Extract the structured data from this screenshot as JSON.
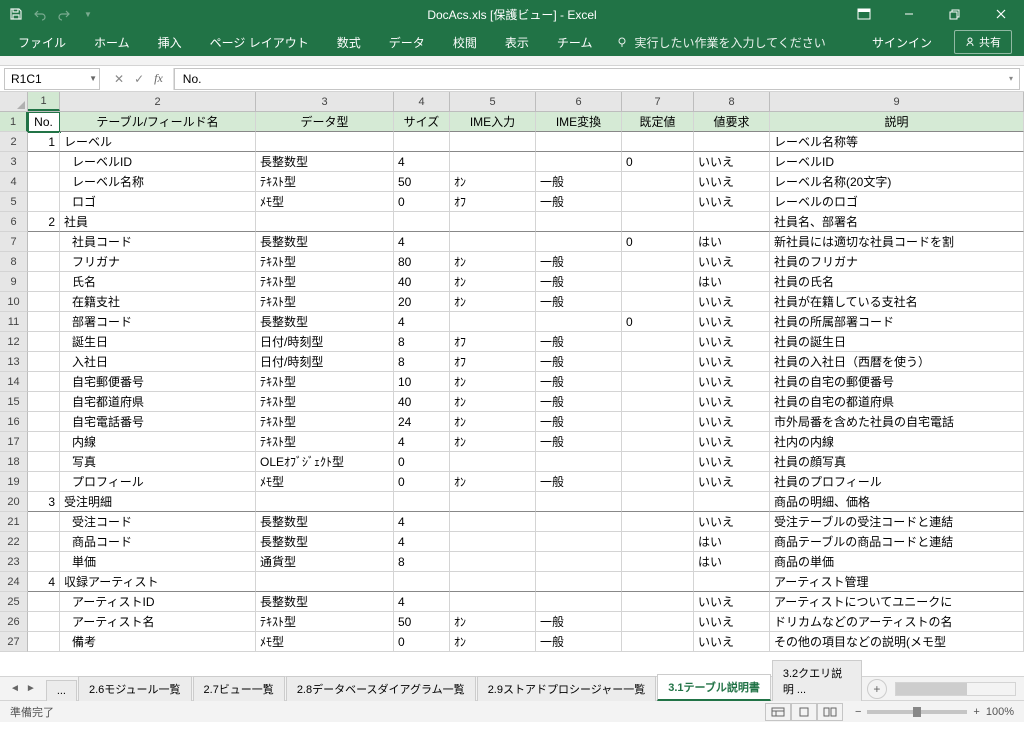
{
  "title": "DocAcs.xls [保護ビュー] - Excel",
  "qat": {
    "save": "save",
    "undo": "undo",
    "redo": "redo"
  },
  "ribbon_tabs": [
    "ファイル",
    "ホーム",
    "挿入",
    "ページ レイアウト",
    "数式",
    "データ",
    "校閲",
    "表示",
    "チーム"
  ],
  "tell_me": "実行したい作業を入力してください",
  "signin": "サインイン",
  "share": "共有",
  "name_box": "R1C1",
  "formula_value": "No.",
  "col_headers": [
    "1",
    "2",
    "3",
    "4",
    "5",
    "6",
    "7",
    "8",
    "9"
  ],
  "header_row": [
    "No.",
    "テーブル/フィールド名",
    "データ型",
    "サイズ",
    "IME入力",
    "IME変換",
    "既定値",
    "値要求",
    "説明"
  ],
  "rows": [
    {
      "s": true,
      "no": "1",
      "c": [
        "レーベル",
        "",
        "",
        "",
        "",
        "",
        "",
        "レーベル名称等"
      ]
    },
    {
      "c": [
        "レーベルID",
        "長整数型",
        "4",
        "",
        "",
        "0",
        "いいえ",
        "レーベルID"
      ]
    },
    {
      "c": [
        "レーベル名称",
        "ﾃｷｽﾄ型",
        "50",
        "ｵﾝ",
        "一般",
        "",
        "いいえ",
        "レーベル名称(20文字)"
      ]
    },
    {
      "c": [
        "ロゴ",
        "ﾒﾓ型",
        "0",
        "ｵﾌ",
        "一般",
        "",
        "いいえ",
        "レーベルのロゴ"
      ]
    },
    {
      "s": true,
      "no": "2",
      "c": [
        "社員",
        "",
        "",
        "",
        "",
        "",
        "",
        "社員名、部署名"
      ]
    },
    {
      "c": [
        "社員コード",
        "長整数型",
        "4",
        "",
        "",
        "0",
        "はい",
        "新社員には適切な社員コードを割"
      ]
    },
    {
      "c": [
        "フリガナ",
        "ﾃｷｽﾄ型",
        "80",
        "ｵﾝ",
        "一般",
        "",
        "いいえ",
        "社員のフリガナ"
      ]
    },
    {
      "c": [
        "氏名",
        "ﾃｷｽﾄ型",
        "40",
        "ｵﾝ",
        "一般",
        "",
        "はい",
        "社員の氏名"
      ]
    },
    {
      "c": [
        "在籍支社",
        "ﾃｷｽﾄ型",
        "20",
        "ｵﾝ",
        "一般",
        "",
        "いいえ",
        "社員が在籍している支社名"
      ]
    },
    {
      "c": [
        "部署コード",
        "長整数型",
        "4",
        "",
        "",
        "0",
        "いいえ",
        "社員の所属部署コード"
      ]
    },
    {
      "c": [
        "誕生日",
        "日付/時刻型",
        "8",
        "ｵﾌ",
        "一般",
        "",
        "いいえ",
        "社員の誕生日"
      ]
    },
    {
      "c": [
        "入社日",
        "日付/時刻型",
        "8",
        "ｵﾌ",
        "一般",
        "",
        "いいえ",
        "社員の入社日（西暦を使う）"
      ]
    },
    {
      "c": [
        "自宅郵便番号",
        "ﾃｷｽﾄ型",
        "10",
        "ｵﾝ",
        "一般",
        "",
        "いいえ",
        "社員の自宅の郵便番号"
      ]
    },
    {
      "c": [
        "自宅都道府県",
        "ﾃｷｽﾄ型",
        "40",
        "ｵﾝ",
        "一般",
        "",
        "いいえ",
        "社員の自宅の都道府県"
      ]
    },
    {
      "c": [
        "自宅電話番号",
        "ﾃｷｽﾄ型",
        "24",
        "ｵﾝ",
        "一般",
        "",
        "いいえ",
        "市外局番を含めた社員の自宅電話"
      ]
    },
    {
      "c": [
        "内線",
        "ﾃｷｽﾄ型",
        "4",
        "ｵﾝ",
        "一般",
        "",
        "いいえ",
        "社内の内線"
      ]
    },
    {
      "c": [
        "写真",
        "OLEｵﾌﾞｼﾞｪｸﾄ型",
        "0",
        "",
        "",
        "",
        "いいえ",
        "社員の顔写真"
      ]
    },
    {
      "c": [
        "プロフィール",
        "ﾒﾓ型",
        "0",
        "ｵﾝ",
        "一般",
        "",
        "いいえ",
        "社員のプロフィール"
      ]
    },
    {
      "s": true,
      "no": "3",
      "c": [
        "受注明細",
        "",
        "",
        "",
        "",
        "",
        "",
        "商品の明細、価格"
      ]
    },
    {
      "c": [
        "受注コード",
        "長整数型",
        "4",
        "",
        "",
        "",
        "いいえ",
        "受注テーブルの受注コードと連結"
      ]
    },
    {
      "c": [
        "商品コード",
        "長整数型",
        "4",
        "",
        "",
        "",
        "はい",
        "商品テーブルの商品コードと連結"
      ]
    },
    {
      "c": [
        "単価",
        "通貨型",
        "8",
        "",
        "",
        "",
        "はい",
        "商品の単価"
      ]
    },
    {
      "s": true,
      "no": "4",
      "c": [
        "収録アーティスト",
        "",
        "",
        "",
        "",
        "",
        "",
        "アーティスト管理"
      ]
    },
    {
      "c": [
        "アーティストID",
        "長整数型",
        "4",
        "",
        "",
        "",
        "いいえ",
        "アーティストについてユニークに"
      ]
    },
    {
      "c": [
        "アーティスト名",
        "ﾃｷｽﾄ型",
        "50",
        "ｵﾝ",
        "一般",
        "",
        "いいえ",
        "ドリカムなどのアーティストの名"
      ]
    },
    {
      "c": [
        "備考",
        "ﾒﾓ型",
        "0",
        "ｵﾝ",
        "一般",
        "",
        "いいえ",
        "その他の項目などの説明(メモ型"
      ]
    }
  ],
  "sheet_tabs": [
    {
      "label": "...",
      "active": false,
      "trunc": true
    },
    {
      "label": "2.6モジュール一覧",
      "active": false
    },
    {
      "label": "2.7ビュー一覧",
      "active": false
    },
    {
      "label": "2.8データベースダイアグラム一覧",
      "active": false
    },
    {
      "label": "2.9ストアドプロシージャー一覧",
      "active": false
    },
    {
      "label": "3.1テーブル説明書",
      "active": true
    },
    {
      "label": "3.2クエリ説明 ...",
      "active": false,
      "trunc": true
    }
  ],
  "status": "準備完了",
  "zoom": "100%"
}
